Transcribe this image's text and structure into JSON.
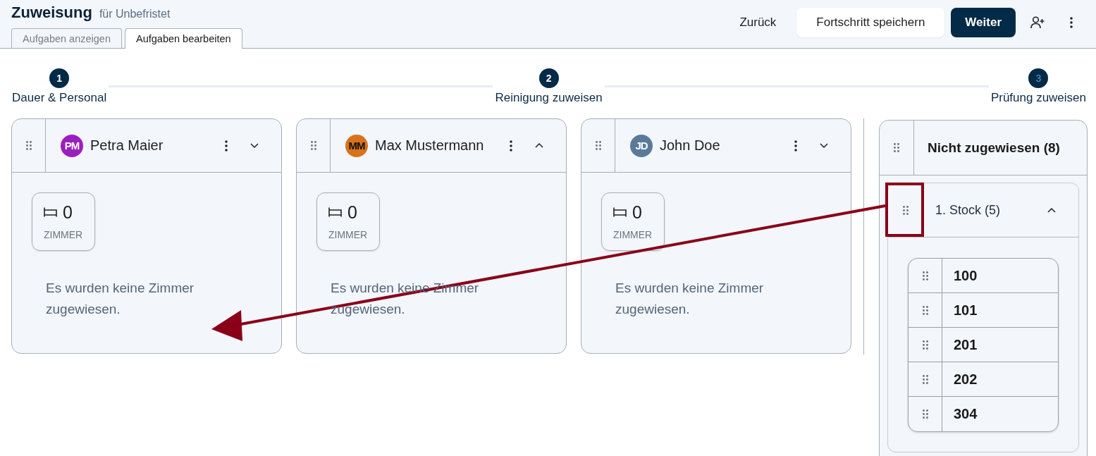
{
  "header": {
    "title": "Zuweisung",
    "subtitle": "für Unbefristet",
    "tabs": [
      {
        "label": "Aufgaben anzeigen",
        "selected": false
      },
      {
        "label": "Aufgaben bearbeiten",
        "selected": true
      }
    ],
    "buttons": [
      {
        "kind": "link",
        "label": "Zurück"
      },
      {
        "kind": "secondary",
        "label": "Fortschritt speichern"
      },
      {
        "kind": "primary",
        "label": "Weiter"
      }
    ]
  },
  "steps": [
    {
      "number": "1",
      "label": "Dauer & Personal",
      "active": true
    },
    {
      "number": "2",
      "label": "Reinigung zuweisen",
      "active": true
    },
    {
      "number": "3",
      "label": "Prüfung zuweisen",
      "active": false
    }
  ],
  "staff": [
    {
      "initials": "PM",
      "name": "Petra Maier",
      "color": "#9b1fbe",
      "expanded": false,
      "room_count": "0",
      "count_label": "ZIMMER",
      "message": "Es wurden keine Zimmer zugewiesen."
    },
    {
      "initials": "MM",
      "name": "Max Mustermann",
      "color": "#d8731b",
      "expanded": true,
      "room_count": "0",
      "count_label": "ZIMMER",
      "message": "Es wurden keine Zimmer zugewiesen."
    },
    {
      "initials": "JD",
      "name": "John Doe",
      "color": "#5b7a99",
      "expanded": false,
      "room_count": "0",
      "count_label": "ZIMMER",
      "message": "Es wurden keine Zimmer zugewiesen."
    }
  ],
  "unassigned": {
    "title": "Nicht zugewiesen (8)",
    "groups": [
      {
        "title": "1. Stock (5)",
        "expanded": true,
        "rooms": [
          "100",
          "101",
          "201",
          "202",
          "304"
        ]
      }
    ]
  }
}
